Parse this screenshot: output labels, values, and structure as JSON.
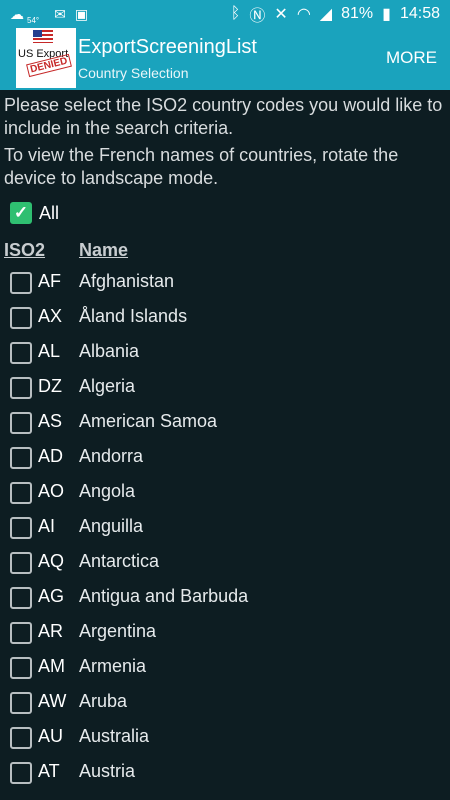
{
  "status_bar": {
    "temp": "54°",
    "battery": "81%",
    "time": "14:58"
  },
  "app_bar": {
    "logo_text": "US Export",
    "logo_stamp": "DENIED",
    "title": "ExportScreeningList",
    "subtitle": "Country Selection",
    "more_label": "MORE"
  },
  "instructions": {
    "line1": "Please select the ISO2 country codes you would like to include in the search criteria.",
    "line2": "To view the French names of countries, rotate the device to landscape mode."
  },
  "all_option": {
    "label": "All",
    "checked": true
  },
  "columns": {
    "iso2": "ISO2",
    "name": "Name"
  },
  "countries": [
    {
      "code": "AF",
      "name": "Afghanistan",
      "checked": false
    },
    {
      "code": "AX",
      "name": "Åland Islands",
      "checked": false
    },
    {
      "code": "AL",
      "name": "Albania",
      "checked": false
    },
    {
      "code": "DZ",
      "name": "Algeria",
      "checked": false
    },
    {
      "code": "AS",
      "name": "American Samoa",
      "checked": false
    },
    {
      "code": "AD",
      "name": "Andorra",
      "checked": false
    },
    {
      "code": "AO",
      "name": "Angola",
      "checked": false
    },
    {
      "code": "AI",
      "name": "Anguilla",
      "checked": false
    },
    {
      "code": "AQ",
      "name": "Antarctica",
      "checked": false
    },
    {
      "code": "AG",
      "name": "Antigua and Barbuda",
      "checked": false
    },
    {
      "code": "AR",
      "name": "Argentina",
      "checked": false
    },
    {
      "code": "AM",
      "name": "Armenia",
      "checked": false
    },
    {
      "code": "AW",
      "name": "Aruba",
      "checked": false
    },
    {
      "code": "AU",
      "name": "Australia",
      "checked": false
    },
    {
      "code": "AT",
      "name": "Austria",
      "checked": false
    }
  ],
  "colors": {
    "accent": "#1aa3bd",
    "background": "#0d1d22",
    "checked": "#2fbf71"
  }
}
